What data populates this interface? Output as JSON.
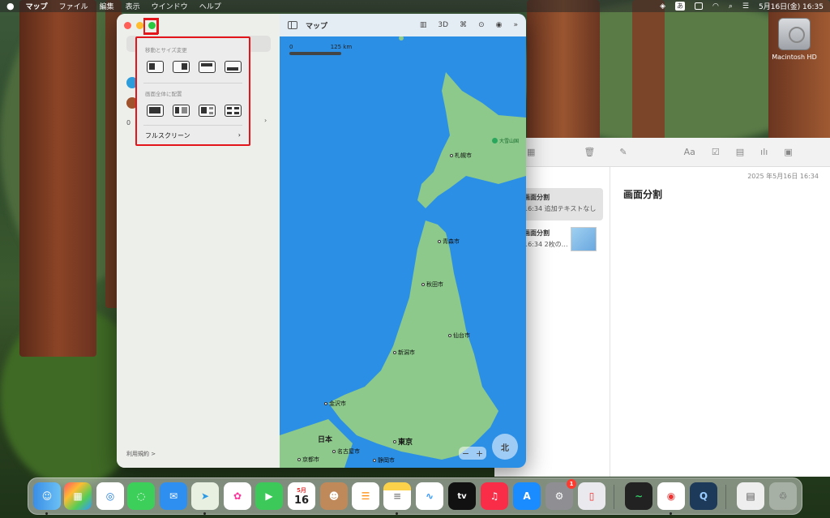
{
  "menubar": {
    "apple": "",
    "items": [
      "マップ",
      "ファイル",
      "編集",
      "表示",
      "ウインドウ",
      "ヘルプ"
    ],
    "input_mode": "あ",
    "datetime": "5月16日(金)  16:35"
  },
  "desktop": {
    "hd_label": "Macintosh HD"
  },
  "maps": {
    "title": "マップ",
    "tools": [
      "3D"
    ],
    "scale_start": "0",
    "scale_end": "125 km",
    "terms": "利用規約 >",
    "side_count": "0",
    "popup": {
      "section1": "移動とサイズ変更",
      "section2": "画面全体に配置",
      "fullscreen": "フルスクリーン",
      "chevron": "›"
    },
    "cities": {
      "sapporo": "札幌市",
      "aomori": "青森市",
      "akita": "秋田市",
      "sendai": "仙台市",
      "niigata": "新潟市",
      "kanazawa": "金沢市",
      "nagoya": "名古屋市",
      "kyoto": "京都市",
      "tokyo": "東京",
      "shizuoka": "静岡市"
    },
    "poi": "大雪山国",
    "country": "日本",
    "compass": "北",
    "zoom_minus": "−",
    "zoom_plus": "+"
  },
  "notes": {
    "date": "2025 年5月16日 16:34",
    "title": "画面分割",
    "list": [
      {
        "title": "画面分割",
        "sub": "16:34  追加テキストなし"
      },
      {
        "title": "画面分割",
        "sub": "16:34  2枚の…"
      }
    ]
  },
  "dock": {
    "calendar_month": "5月",
    "calendar_day": "16",
    "appstore_badge": "1",
    "tv": "tv"
  }
}
